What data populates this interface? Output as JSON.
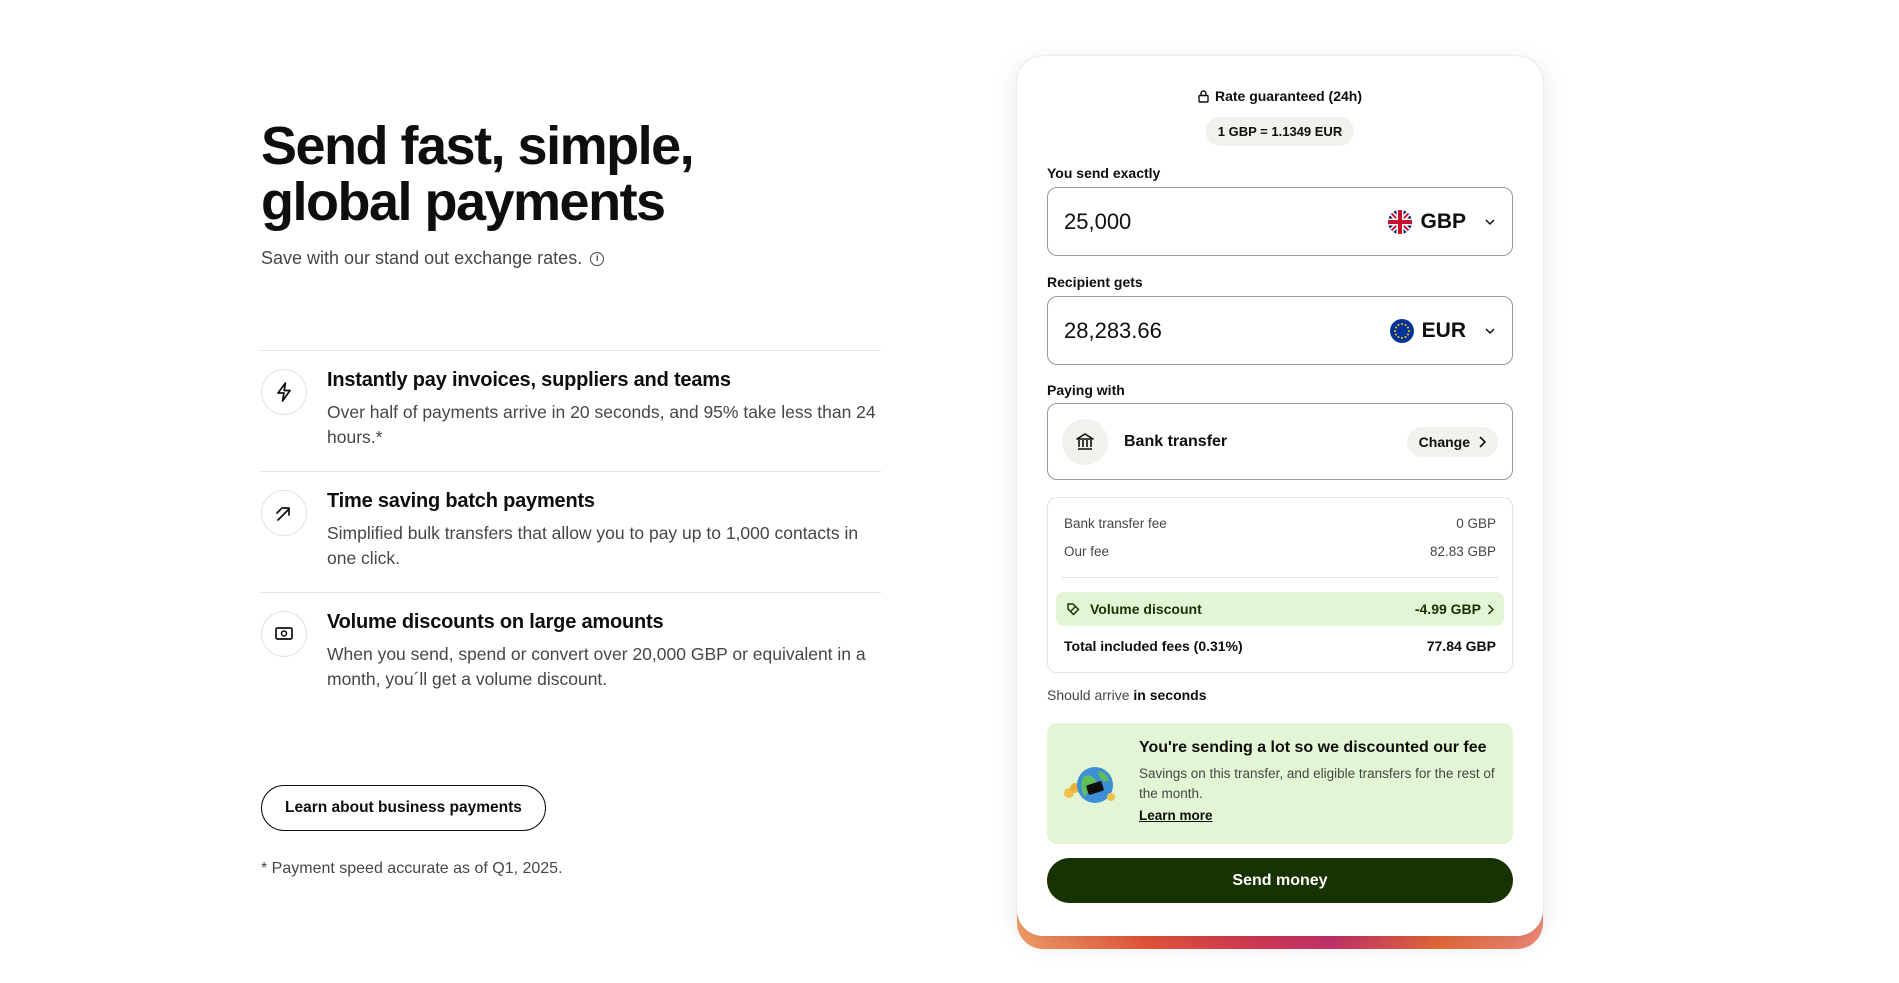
{
  "hero": {
    "title": "Send fast, simple, global payments",
    "subtitle": "Save with our stand out exchange rates."
  },
  "features": [
    {
      "icon": "lightning-icon",
      "title": "Instantly pay invoices, suppliers and teams",
      "desc": "Over half of payments arrive in 20 seconds, and 95% take less than 24 hours.*"
    },
    {
      "icon": "batch-arrow-icon",
      "title": "Time saving batch payments",
      "desc": "Simplified bulk transfers that allow you to pay up to 1,000 contacts in one click."
    },
    {
      "icon": "cash-icon",
      "title": "Volume discounts on large amounts",
      "desc": "When you send, spend or convert over 20,000 GBP or equivalent in a month, you´ll get a volume discount."
    }
  ],
  "learn_button": "Learn about business payments",
  "footnote": "* Payment speed accurate as of Q1, 2025.",
  "calculator": {
    "rate_guarantee": "Rate guaranteed (24h)",
    "rate": "1 GBP = 1.1349 EUR",
    "send_label": "You send exactly",
    "send_amount": "25,000",
    "send_currency": "GBP",
    "receive_label": "Recipient gets",
    "receive_amount": "28,283.66",
    "receive_currency": "EUR",
    "paying_label": "Paying with",
    "payment_method": "Bank transfer",
    "change_label": "Change",
    "fees": {
      "bank_fee_label": "Bank transfer fee",
      "bank_fee_value": "0 GBP",
      "our_fee_label": "Our fee",
      "our_fee_value": "82.83 GBP",
      "volume_label": "Volume discount",
      "volume_value": "-4.99 GBP",
      "total_label": "Total included fees (0.31%)",
      "total_value": "77.84 GBP"
    },
    "arrive_prefix": "Should arrive",
    "arrive_bold": "in seconds",
    "promo": {
      "title": "You're sending a lot so we discounted our fee",
      "desc": "Savings on this transfer, and eligible transfers for the rest of the month.",
      "link": "Learn more"
    },
    "send_button": "Send money"
  },
  "colors": {
    "primary_dark": "#163300",
    "accent_green": "#e2f6d5",
    "text": "#0e0f0c",
    "muted": "#454745"
  }
}
